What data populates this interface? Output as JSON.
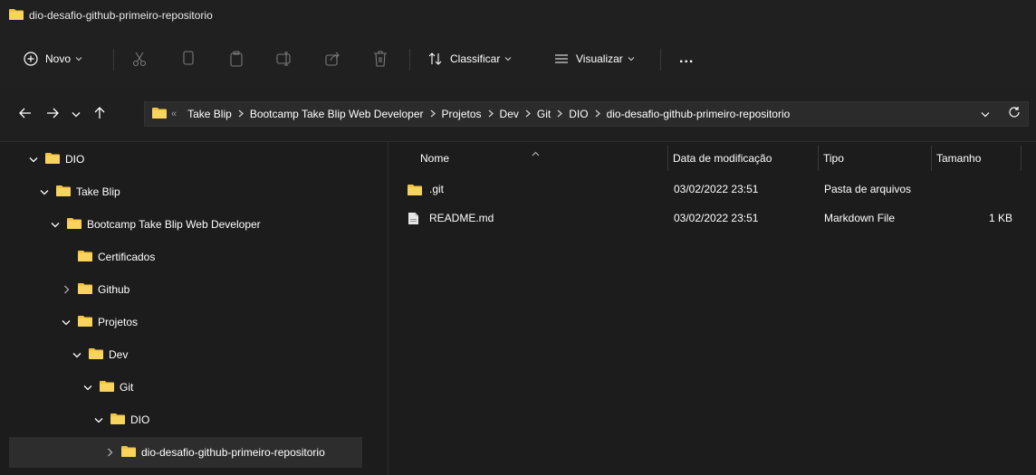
{
  "window": {
    "title": "dio-desafio-github-primeiro-repositorio"
  },
  "toolbar": {
    "new_label": "Novo",
    "sort_label": "Classificar",
    "view_label": "Visualizar",
    "more_label": "..."
  },
  "address": {
    "overflow": "«",
    "breadcrumbs": [
      "Take Blip",
      "Bootcamp Take Blip Web Developer",
      "Projetos",
      "Dev",
      "Git",
      "DIO",
      "dio-desafio-github-primeiro-repositorio"
    ]
  },
  "tree": [
    {
      "label": "DIO",
      "depth": 0,
      "expanded": true,
      "has_children": true
    },
    {
      "label": "Take Blip",
      "depth": 1,
      "expanded": true,
      "has_children": true
    },
    {
      "label": "Bootcamp Take Blip Web Developer",
      "depth": 2,
      "expanded": true,
      "has_children": true
    },
    {
      "label": "Certificados",
      "depth": 3,
      "expanded": false,
      "has_children": false
    },
    {
      "label": "Github",
      "depth": 3,
      "expanded": false,
      "has_children": true
    },
    {
      "label": "Projetos",
      "depth": 3,
      "expanded": true,
      "has_children": true
    },
    {
      "label": "Dev",
      "depth": 4,
      "expanded": true,
      "has_children": true
    },
    {
      "label": "Git",
      "depth": 5,
      "expanded": true,
      "has_children": true
    },
    {
      "label": "DIO",
      "depth": 6,
      "expanded": true,
      "has_children": true
    },
    {
      "label": "dio-desafio-github-primeiro-repositorio",
      "depth": 7,
      "expanded": false,
      "has_children": true,
      "selected": true
    }
  ],
  "columns": {
    "name": "Nome",
    "modified": "Data de modificação",
    "type": "Tipo",
    "size": "Tamanho"
  },
  "files": [
    {
      "name": ".git",
      "modified": "03/02/2022 23:51",
      "type": "Pasta de arquivos",
      "size": "",
      "icon": "folder-icon"
    },
    {
      "name": "README.md",
      "modified": "03/02/2022 23:51",
      "type": "Markdown File",
      "size": "1 KB",
      "icon": "file-icon"
    }
  ],
  "colors": {
    "folder": "#f3c444",
    "background": "#1c1c1c",
    "titlebar": "#202020",
    "selection": "#2d2d2d"
  }
}
